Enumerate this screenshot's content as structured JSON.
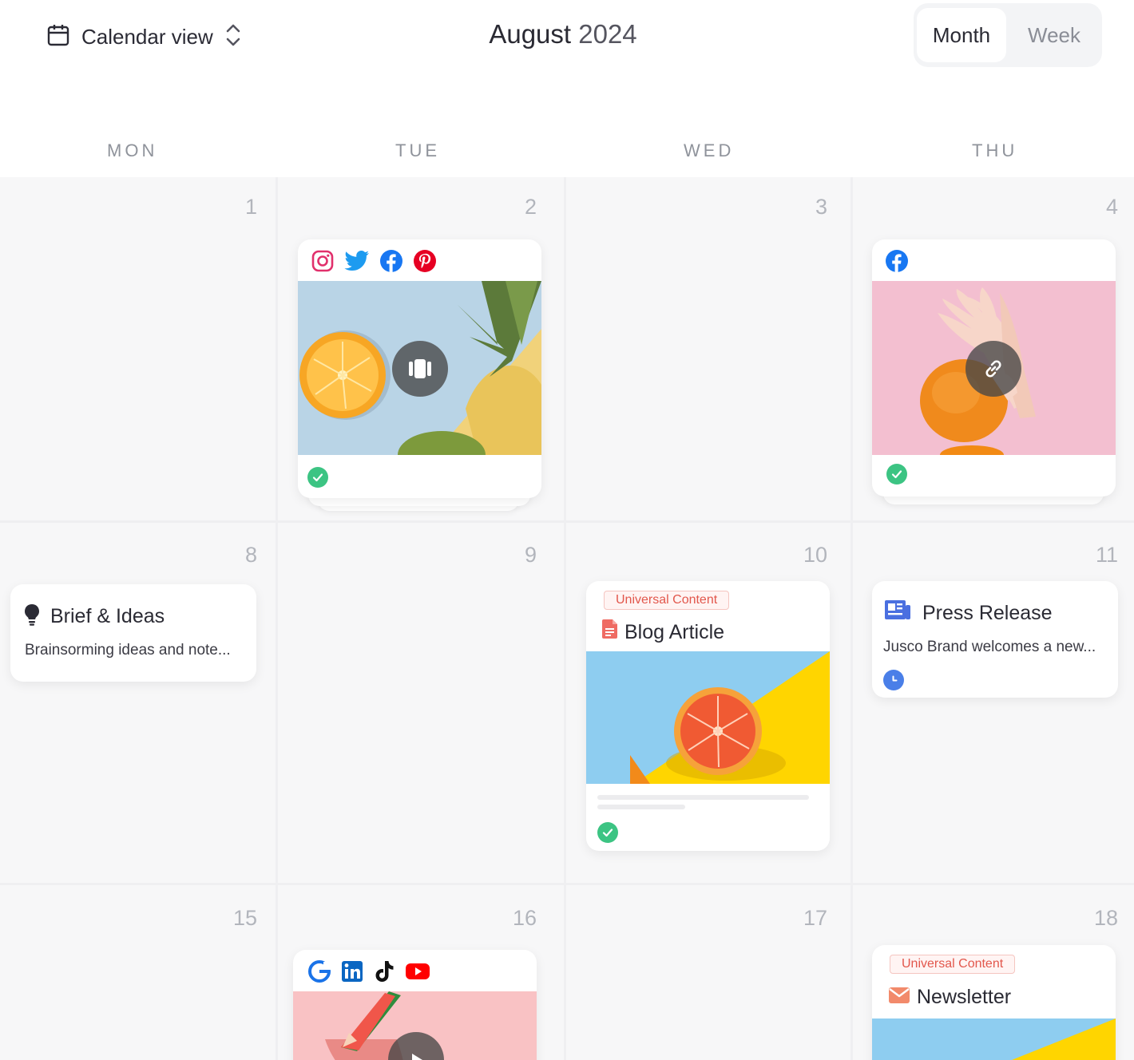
{
  "header": {
    "view_label": "Calendar view",
    "month": "August",
    "year": "2024",
    "toggle": {
      "active": "Month",
      "inactive": "Week"
    }
  },
  "weekdays": [
    "MON",
    "TUE",
    "WED",
    "THU"
  ],
  "days": [
    "1",
    "2",
    "3",
    "4",
    "8",
    "9",
    "10",
    "11",
    "15",
    "16",
    "17",
    "18"
  ],
  "cards": {
    "aug2": {
      "platforms": [
        "instagram-icon",
        "twitter-icon",
        "facebook-icon",
        "pinterest-icon"
      ],
      "overlay": "carousel-icon",
      "status": "approved"
    },
    "aug4": {
      "platforms": [
        "facebook-icon"
      ],
      "overlay": "link-icon",
      "status": "approved"
    },
    "aug8": {
      "title": "Brief & Ideas",
      "desc": "Brainsorming ideas and note..."
    },
    "aug10": {
      "badge": "Universal Content",
      "title": "Blog Article",
      "status": "approved"
    },
    "aug11": {
      "title": "Press Release",
      "desc": "Jusco Brand welcomes a new...",
      "status": "scheduled"
    },
    "aug16": {
      "platforms": [
        "google-business-icon",
        "linkedin-icon",
        "tiktok-icon",
        "youtube-icon"
      ],
      "overlay": "play-icon"
    },
    "aug18": {
      "badge": "Universal Content",
      "title": "Newsletter"
    }
  },
  "colors": {
    "check": "#3cc483",
    "clock": "#4a7fe8",
    "badge_text": "#e2574c",
    "instagram": "#e1306c",
    "twitter": "#1d9bf0",
    "facebook": "#1877f2",
    "pinterest": "#e60023",
    "linkedin": "#0a66c2",
    "youtube": "#ff0000"
  }
}
